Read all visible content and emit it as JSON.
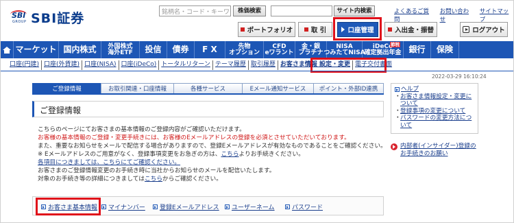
{
  "header": {
    "logo_mark": "SBI",
    "logo_group": "GROUP",
    "logo_text": "SBI証券",
    "search_placeholder": "銘柄名・コード・キーワード",
    "stock_search_button": "株価検索",
    "site_search_button": "サイト内検索",
    "top_links": [
      "よくあるご質問",
      "お問い合わせ",
      "サイトマップ"
    ],
    "portfolio_button": "ポートフォリオ",
    "trade_button": "取 引",
    "account_button": "口座管理",
    "deposit_button": "入出金・振替",
    "logout_button": "ログアウト"
  },
  "mainnav": {
    "items": [
      {
        "label": "マーケット"
      },
      {
        "label": "国内株式"
      },
      {
        "label": "外国株式\n海外ETF"
      },
      {
        "label": "投信"
      },
      {
        "label": "債券"
      },
      {
        "label": "F X"
      },
      {
        "label": "先物\nオプション"
      },
      {
        "label": "CFD\neワラント"
      },
      {
        "label": "金・銀\nプラチナ"
      },
      {
        "label": "NISA\nつみたてNISA"
      },
      {
        "label": "iDeCo\n確定拠出年金",
        "badge": "節税"
      },
      {
        "label": "銀行"
      },
      {
        "label": "保険"
      }
    ]
  },
  "subnav": {
    "items": [
      "口座(円建)",
      "口座(外貨建)",
      "口座(NISA)",
      "口座(iDeCo)",
      "トータルリターン",
      "テーマ履歴",
      "取引履歴",
      "お客さま情報 設定・変更",
      "電子交付書面"
    ]
  },
  "timestamp": "2022-03-29 16:10:24",
  "tabs": [
    "ご登録情報",
    "お取引関連・口座情報",
    "各種サービス",
    "Eメール通知サービス",
    "ポイント・外部ID連携"
  ],
  "page_title": "ご登録情報",
  "body": {
    "p1": "こちらのページにてお客さまの基本情報のご登録内容がご確認いただけます。",
    "p2_red": "お客様の基本情報のご登録・変更手続きには、お客様のEメールアドレスの登録を必須とさせていただいております。",
    "p3": "また、重要なお知らせをメールで配信する場合がありますので、登録Eメールアドレスが有効なものであることをご確認ください。",
    "p4_pre": "※ Eメールアドレスのご用意がなく、登録事項変更をお急ぎの方は、",
    "p4_link": "こちら",
    "p4_post": "よりお手続きください。",
    "p5_link": "各項目につきましては、こちらにてご確認ください。",
    "p6": "お客さまのご登録情報変更のお手続き時に当社からお知らせのメールを配信いたします。",
    "p7_pre": "対象のお手続き等の詳細につきましては",
    "p7_link": "こちら",
    "p7_post": "からご確認ください。"
  },
  "bottom_menu": [
    "お客さま基本情報",
    "マイナンバー",
    "登録Eメールアドレス",
    "ユーザーネーム",
    "パスワード"
  ],
  "help": {
    "heading": "ヘルプ",
    "links": [
      "お客さま情報設定・変更について",
      "登録事項の変更について",
      "パスワードの変更方法について"
    ]
  },
  "insider_link": "内部者(インサイダー)登録のお手続きのお願い",
  "colors": {
    "brand_blue": "#1d56b5",
    "highlight_red": "#e0101a",
    "warning_red": "#d01818"
  }
}
